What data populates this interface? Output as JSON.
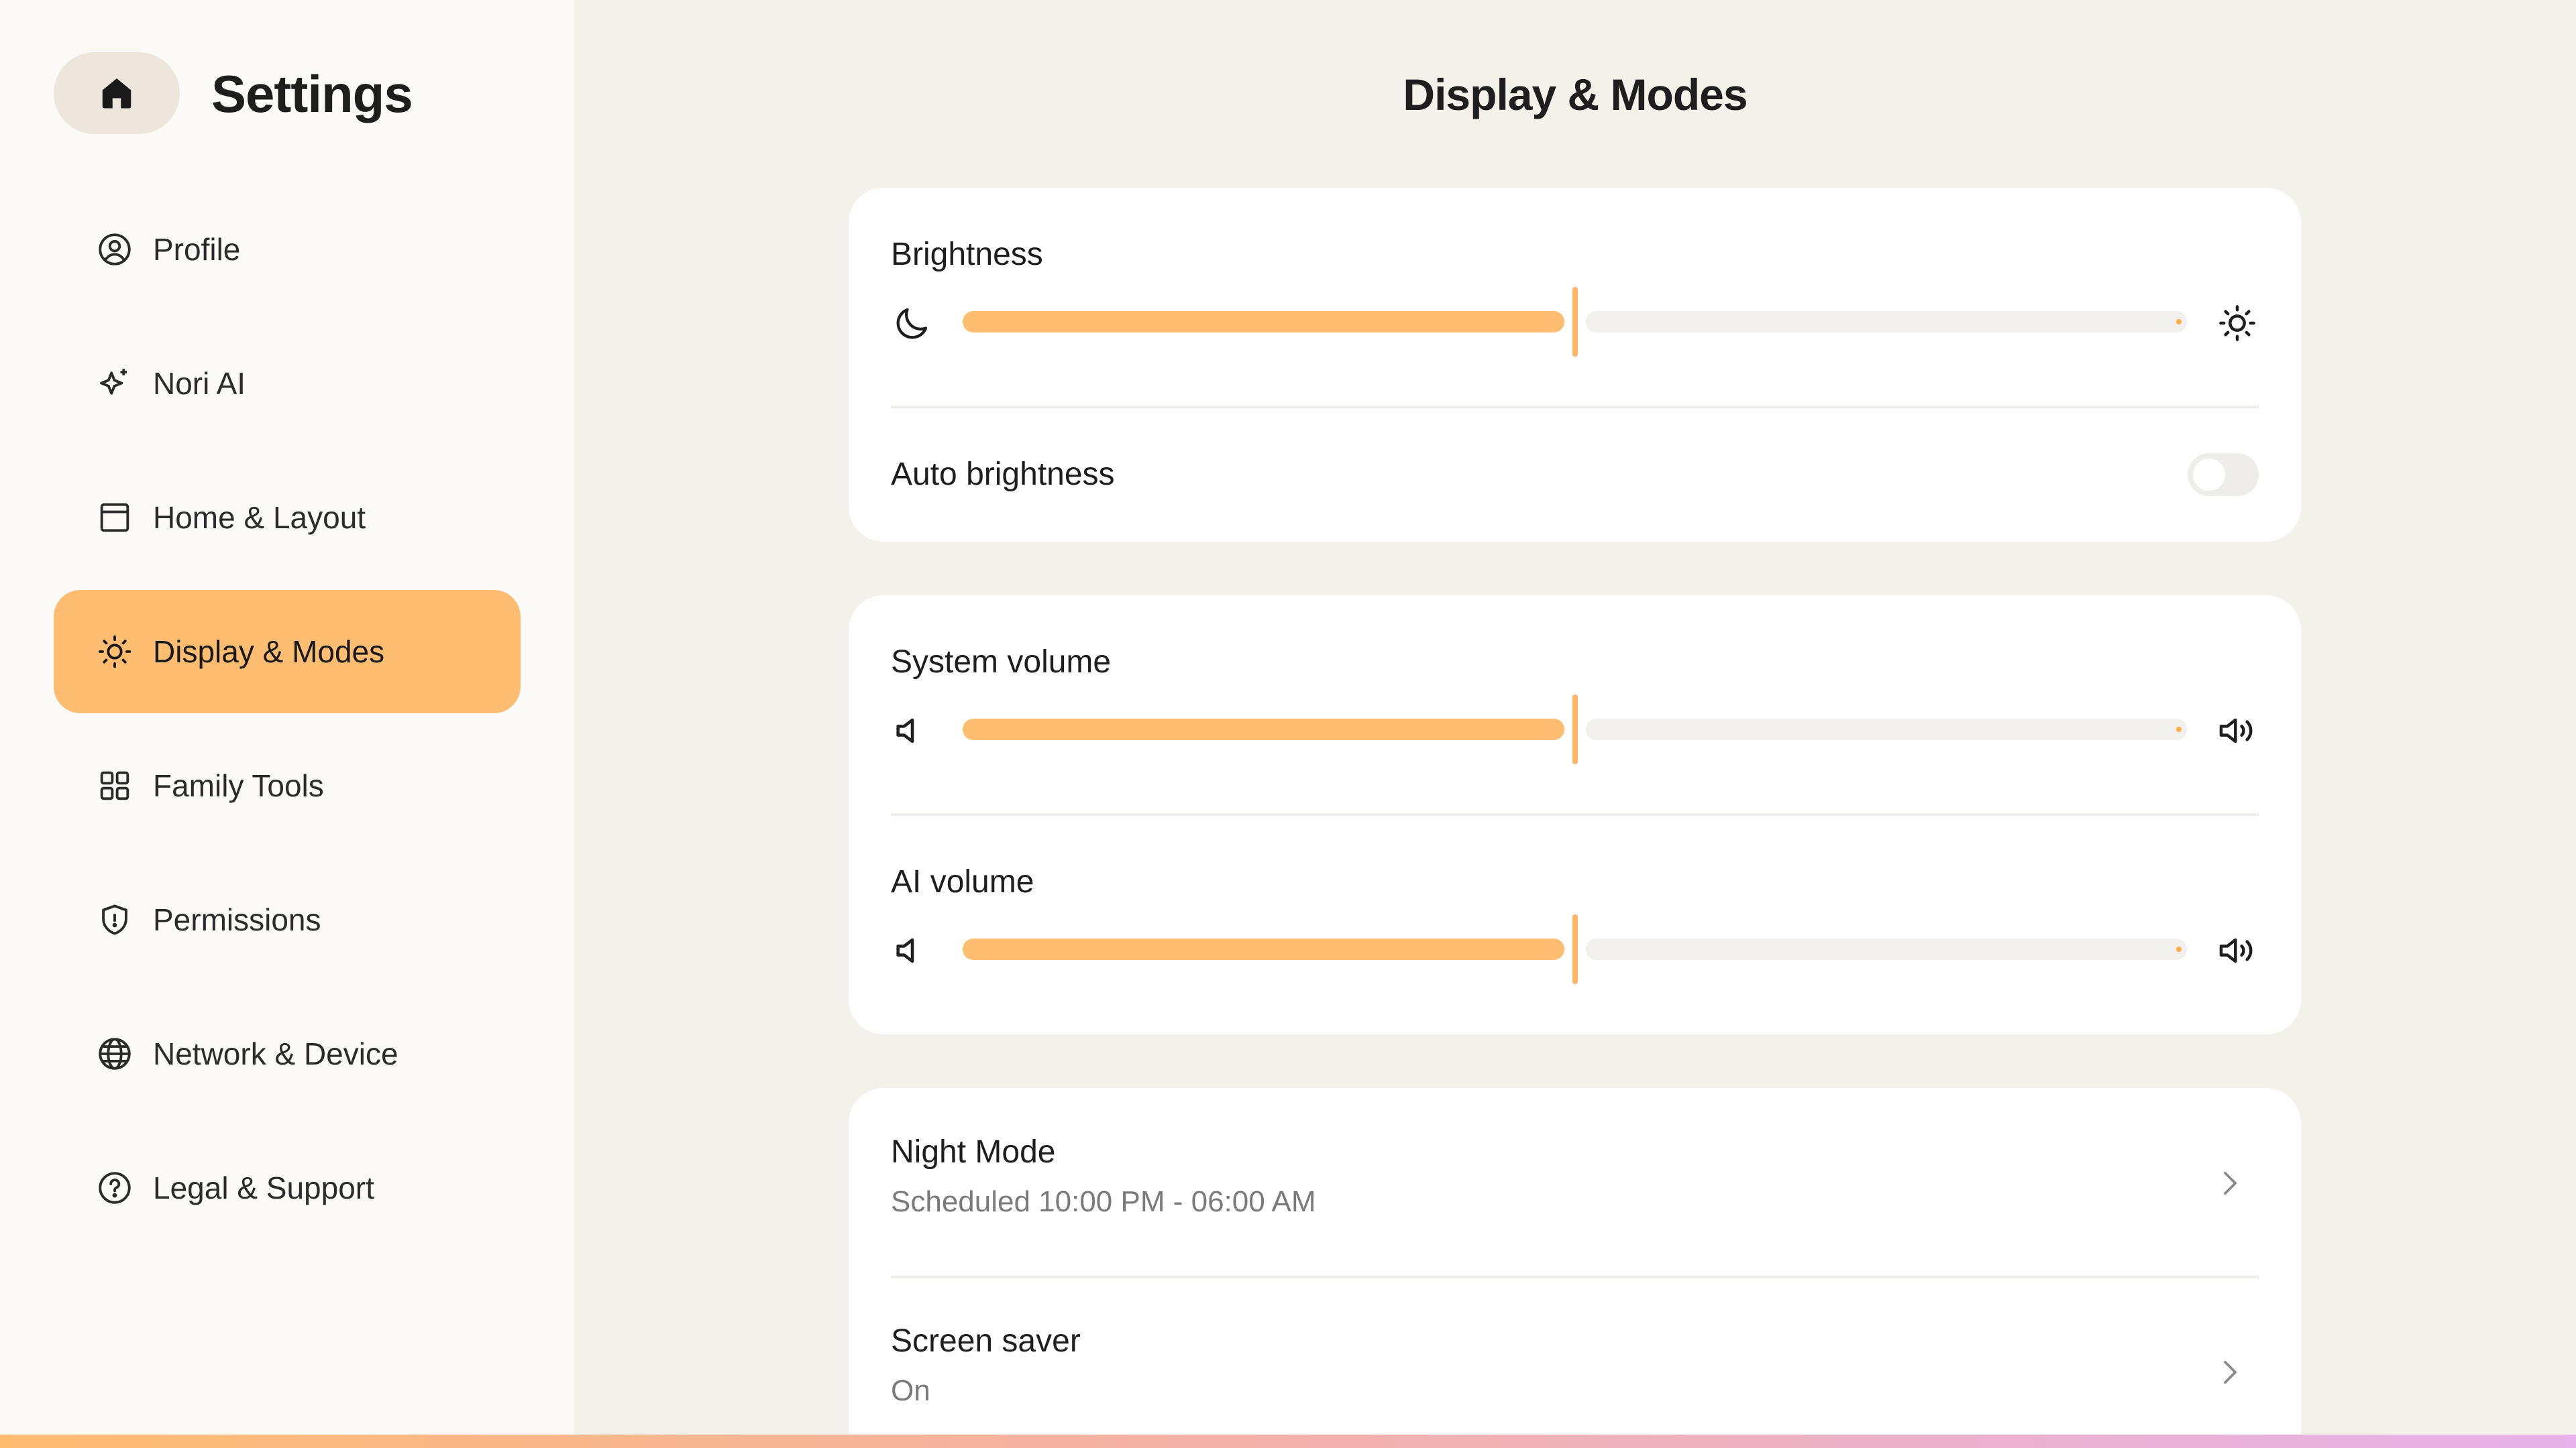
{
  "sidebar": {
    "title": "Settings",
    "home_icon": "home-icon",
    "items": [
      {
        "label": "Profile",
        "icon": "user-circle-icon"
      },
      {
        "label": "Nori AI",
        "icon": "sparkle-icon"
      },
      {
        "label": "Home & Layout",
        "icon": "layout-icon"
      },
      {
        "label": "Display & Modes",
        "icon": "sun-icon",
        "active": true
      },
      {
        "label": "Family Tools",
        "icon": "grid-icon"
      },
      {
        "label": "Permissions",
        "icon": "shield-icon"
      },
      {
        "label": "Network & Device",
        "icon": "globe-icon"
      },
      {
        "label": "Legal & Support",
        "icon": "help-circle-icon"
      }
    ]
  },
  "main": {
    "title": "Display & Modes",
    "brightness": {
      "label": "Brightness",
      "value_percent": 50,
      "left_icon": "moon-icon",
      "right_icon": "sun-icon"
    },
    "auto_brightness": {
      "label": "Auto brightness",
      "enabled": false
    },
    "system_volume": {
      "label": "System volume",
      "value_percent": 50,
      "left_icon": "volume-low-icon",
      "right_icon": "volume-high-icon"
    },
    "ai_volume": {
      "label": "AI volume",
      "value_percent": 50,
      "left_icon": "volume-low-icon",
      "right_icon": "volume-high-icon"
    },
    "night_mode": {
      "label": "Night Mode",
      "value": "Scheduled 10:00 PM - 06:00 AM"
    },
    "screen_saver": {
      "label": "Screen saver",
      "value": "On"
    }
  },
  "colors": {
    "accent": "#ffbd72",
    "sidebar_bg": "#fbfaf6",
    "main_bg": "#f4f1ea",
    "card_bg": "#ffffff"
  }
}
